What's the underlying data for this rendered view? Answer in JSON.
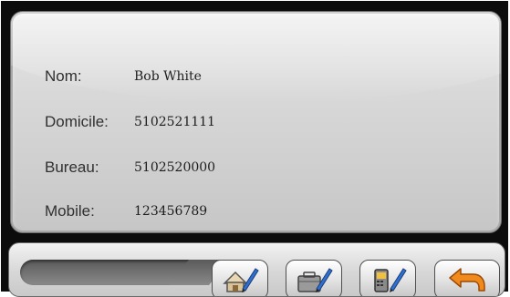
{
  "contact": {
    "fields": [
      {
        "label": "Nom:",
        "value": "Bob White"
      },
      {
        "label": "Domicile:",
        "value": "5102521111"
      },
      {
        "label": "Bureau:",
        "value": "5102520000"
      },
      {
        "label": "Mobile:",
        "value": "123456789"
      }
    ]
  },
  "toolbar": {
    "buttons": [
      {
        "icon": "edit-home-icon"
      },
      {
        "icon": "edit-office-icon"
      },
      {
        "icon": "edit-mobile-icon"
      },
      {
        "icon": "back-arrow-icon"
      }
    ]
  },
  "colors": {
    "frame": "#0c0c0c",
    "card": "#d9d9d9",
    "back_arrow": "#f08a1c",
    "pencil": "#2f6fd0"
  }
}
